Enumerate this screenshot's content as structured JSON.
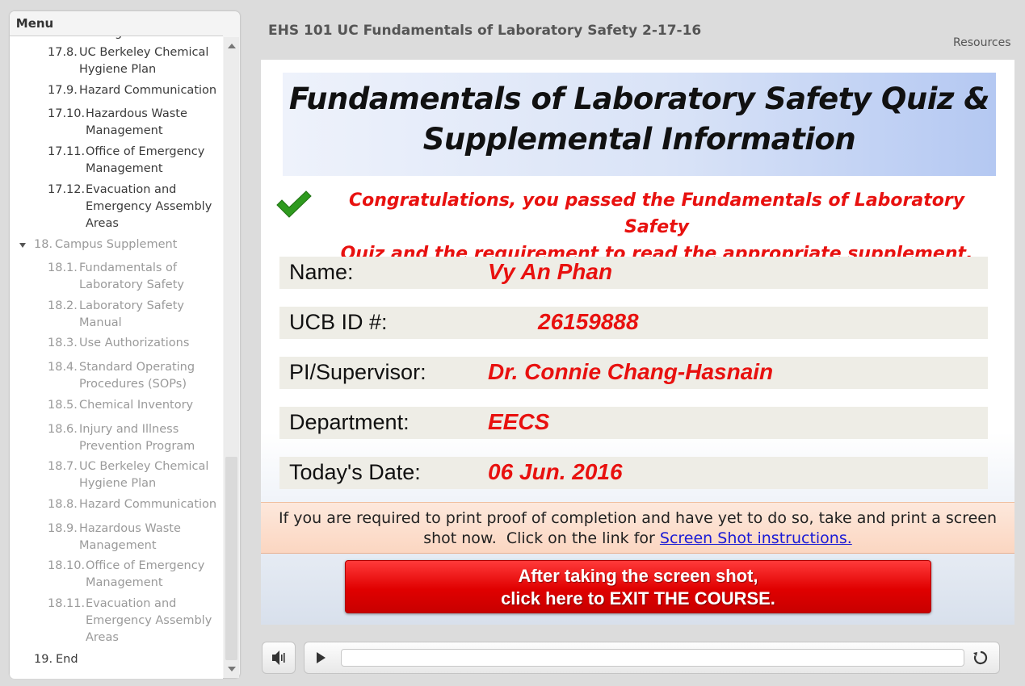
{
  "menu": {
    "tab_label": "Menu",
    "items": [
      {
        "num": "17.8.",
        "text": "UC Berkeley Chemical",
        "text2": "Hygiene Plan",
        "dim": false
      },
      {
        "num": "17.9.",
        "text": "Hazard Communication",
        "text2": "",
        "dim": false
      },
      {
        "num": "17.10.",
        "text": "Hazardous Waste",
        "text2": "Management",
        "dim": false
      },
      {
        "num": "17.11.",
        "text": "Office of Emergency",
        "text2": "Management",
        "dim": false
      },
      {
        "num": "17.12.",
        "text": "Evacuation and",
        "text2": "Emergency Assembly",
        "text3": "Areas",
        "dim": false
      },
      {
        "num": "18.",
        "text": "Campus Supplement",
        "dim": true
      },
      {
        "num": "18.1.",
        "text": "Fundamentals of",
        "text2": "Laboratory Safety",
        "dim": true
      },
      {
        "num": "18.2.",
        "text": "Laboratory Safety",
        "text2": "Manual",
        "dim": true
      },
      {
        "num": "18.3.",
        "text": "Use Authorizations",
        "dim": true
      },
      {
        "num": "18.4.",
        "text": "Standard Operating",
        "text2": "Procedures (SOPs)",
        "dim": true
      },
      {
        "num": "18.5.",
        "text": "Chemical Inventory",
        "dim": true
      },
      {
        "num": "18.6.",
        "text": "Injury and Illness",
        "text2": "Prevention Program",
        "dim": true
      },
      {
        "num": "18.7.",
        "text": "UC Berkeley Chemical",
        "text2": "Hygiene Plan",
        "dim": true
      },
      {
        "num": "18.8.",
        "text": "Hazard Communication",
        "dim": true
      },
      {
        "num": "18.9.",
        "text": "Hazardous Waste",
        "text2": "Management",
        "dim": true
      },
      {
        "num": "18.10.",
        "text": "Office of Emergency",
        "text2": "Management",
        "dim": true
      },
      {
        "num": "18.11.",
        "text": "Evacuation and",
        "text2": "Emergency Assembly",
        "text3": "Areas",
        "dim": true
      },
      {
        "num": "19.",
        "text": "End",
        "dim": false
      }
    ]
  },
  "header": {
    "course_title": "EHS 101 UC Fundamentals of Laboratory Safety 2-17-16",
    "resources_label": "Resources"
  },
  "slide": {
    "banner_line1": "Fundamentals of Laboratory Safety Quiz &",
    "banner_line2": "Supplemental Information",
    "congrats_line1": "Congratulations, you passed the Fundamentals of Laboratory Safety",
    "congrats_line2": "Quiz and the requirement to read the appropriate supplement.",
    "fields": {
      "name_label": "Name:",
      "name_value": "Vy An Phan",
      "id_label": "UCB ID #:",
      "id_value": "26159888",
      "pi_label": "PI/Supervisor:",
      "pi_value": "Dr. Connie Chang-Hasnain",
      "dept_label": "Department:",
      "dept_value": "EECS",
      "date_label": "Today's Date:",
      "date_value": "06 Jun. 2016"
    },
    "notice_line1": "If you are required to print proof of completion and have yet to do so, take and print a screen",
    "notice_line2_prefix": "shot now.  Click on the link for ",
    "notice_link": "Screen Shot instructions.",
    "exit_line1": "After taking the screen shot,",
    "exit_line2": "click here to EXIT THE COURSE."
  },
  "colors": {
    "accent_red": "#e8110f",
    "link_blue": "#1a1ad6",
    "check_green": "#2e9a1e"
  },
  "icons": [
    "checkmark-icon",
    "speaker-icon",
    "play-icon",
    "replay-icon",
    "triangle-down-icon",
    "scroll-up-icon",
    "scroll-down-icon"
  ]
}
